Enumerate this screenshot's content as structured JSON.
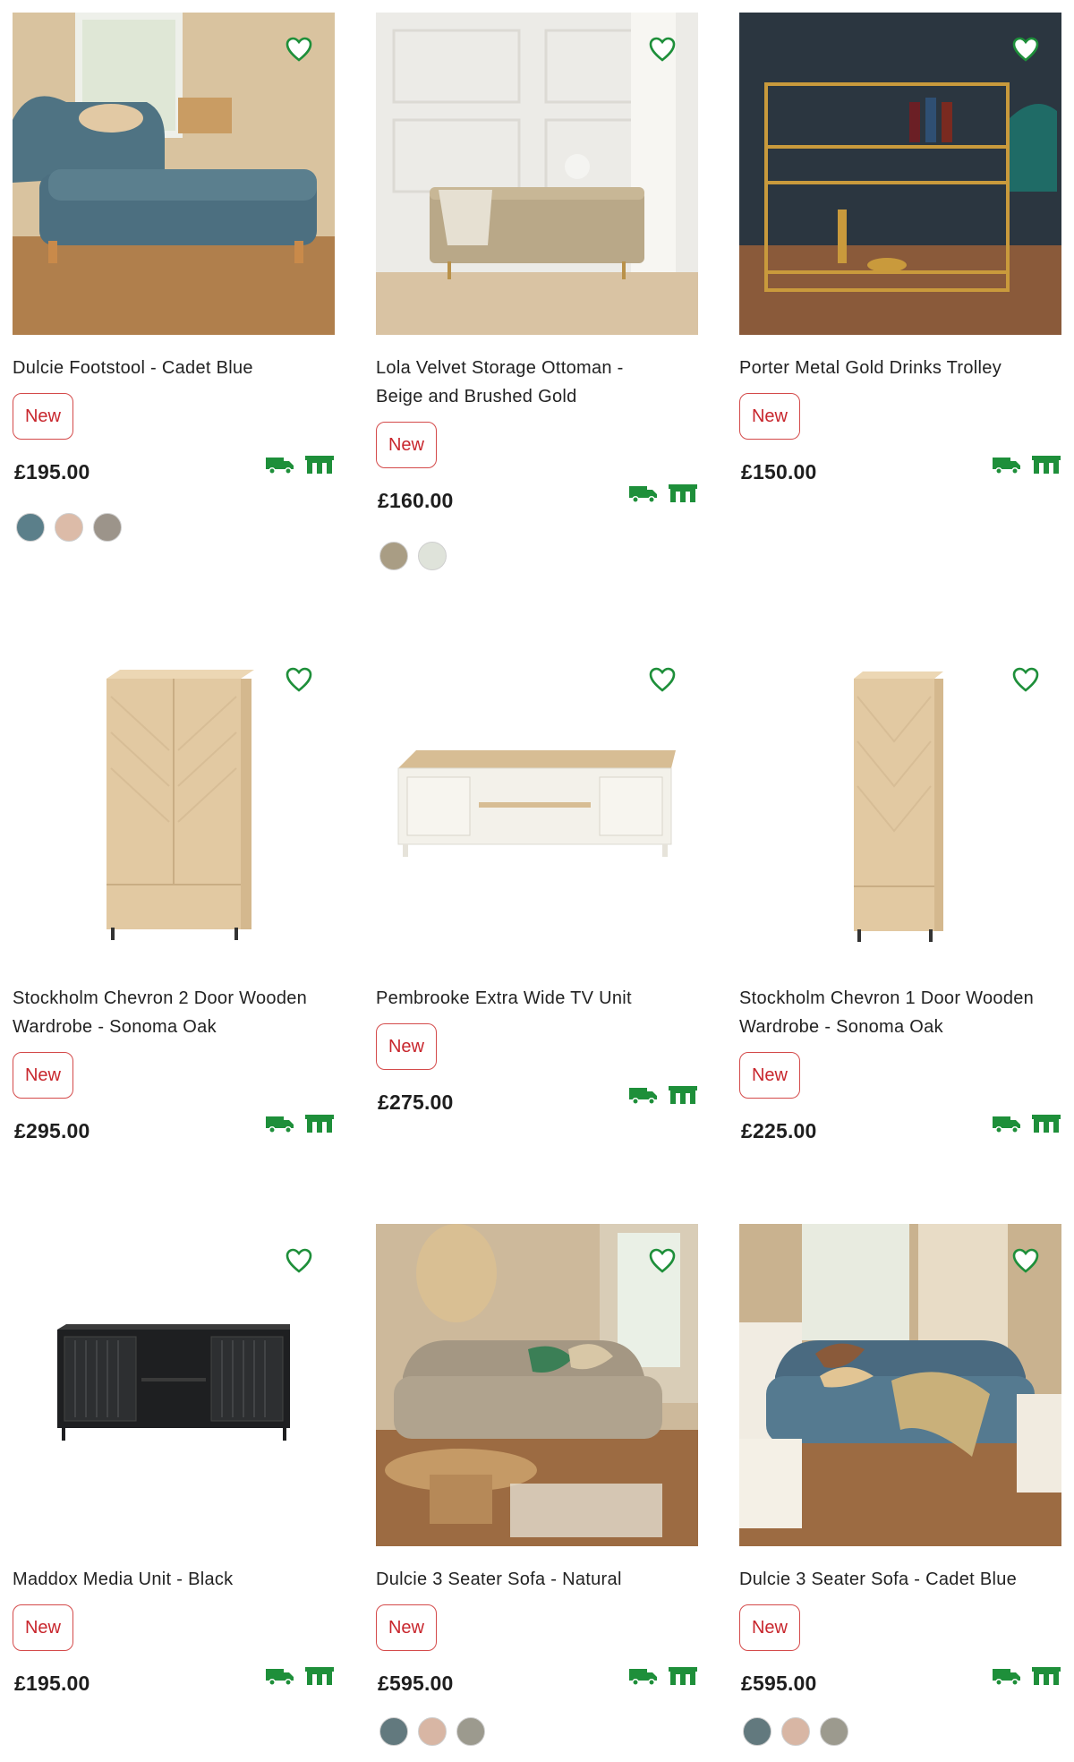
{
  "badge_label": "New",
  "accent_color": "#1e8f3a",
  "badge_color": "#c8262d",
  "products": [
    {
      "title_line1": "Dulcie Footstool - Cadet Blue",
      "title_line2": "",
      "price": "£195.00",
      "swatches": [
        "#5b7f8a",
        "#dcbba8",
        "#9c948a"
      ],
      "image": "blue-footstool-photo"
    },
    {
      "title_line1": "Lola Velvet Storage Ottoman -",
      "title_line2": "Beige and Brushed Gold",
      "price": "£160.00",
      "swatches": [
        "#a99d84",
        "#dfe3da"
      ],
      "image": "beige-ottoman-photo"
    },
    {
      "title_line1": "Porter Metal Gold Drinks Trolley",
      "title_line2": "",
      "price": "£150.00",
      "swatches": [],
      "image": "gold-drinks-trolley-photo"
    },
    {
      "title_line1": "Stockholm Chevron 2 Door Wooden",
      "title_line2": "Wardrobe - Sonoma Oak",
      "price": "£295.00",
      "swatches": [],
      "image": "oak-wardrobe-2-door"
    },
    {
      "title_line1": "Pembrooke Extra Wide TV Unit",
      "title_line2": "",
      "price": "£275.00",
      "swatches": [],
      "image": "white-tv-unit"
    },
    {
      "title_line1": "Stockholm Chevron 1 Door Wooden",
      "title_line2": "Wardrobe - Sonoma Oak",
      "price": "£225.00",
      "swatches": [],
      "image": "oak-wardrobe-1-door"
    },
    {
      "title_line1": "Maddox Media Unit - Black",
      "title_line2": "",
      "price": "£195.00",
      "swatches": [],
      "image": "black-media-unit"
    },
    {
      "title_line1": "Dulcie 3 Seater Sofa - Natural",
      "title_line2": "",
      "price": "£595.00",
      "swatches": [
        "#62797e",
        "#d8b6a4",
        "#9c9a8e"
      ],
      "image": "natural-sofa-photo"
    },
    {
      "title_line1": "Dulcie 3 Seater Sofa - Cadet Blue",
      "title_line2": "",
      "price": "£595.00",
      "swatches": [
        "#62797e",
        "#d8b6a4",
        "#9c9a8e"
      ],
      "image": "blue-sofa-photo"
    }
  ]
}
